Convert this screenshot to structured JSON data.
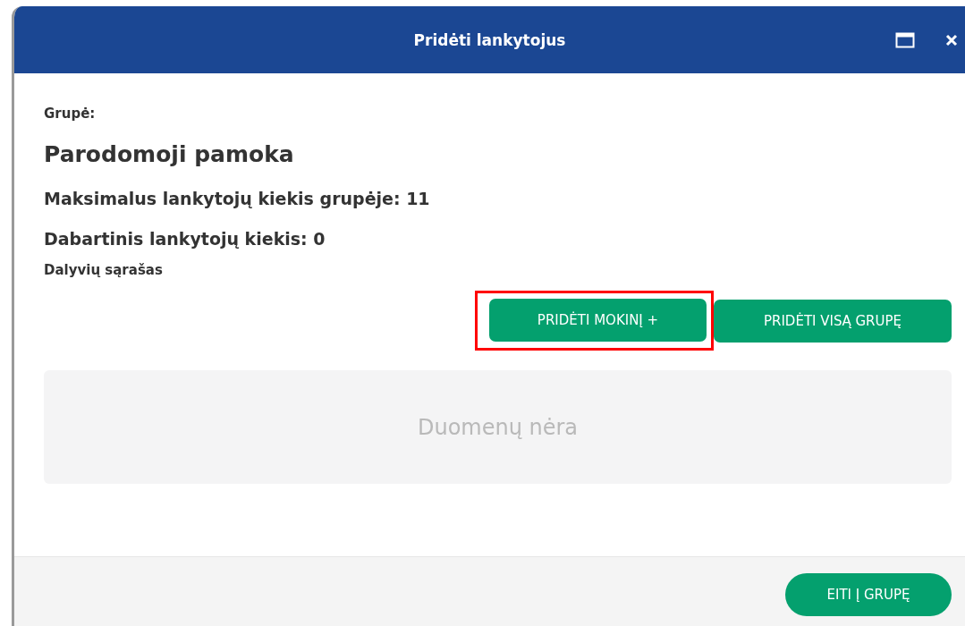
{
  "window": {
    "title": "Pridėti lankytojus"
  },
  "group_label": "Grupė:",
  "group_name": "Parodomoji pamoka",
  "stats": [
    "Maksimalus lankytojų kiekis grupėje: 11",
    "Dabartinis lankytojų kiekis: 0"
  ],
  "participants_heading": "Dalyvių sąrašas",
  "actions": [
    {
      "label": "PRIDĖTI MOKINĮ +",
      "highlighted": true
    },
    {
      "label": "PRIDĖTI VISĄ GRUPĘ",
      "highlighted": false
    }
  ],
  "empty_message": "Duomenų nėra",
  "footer_button": "EITI Į GRUPĘ"
}
